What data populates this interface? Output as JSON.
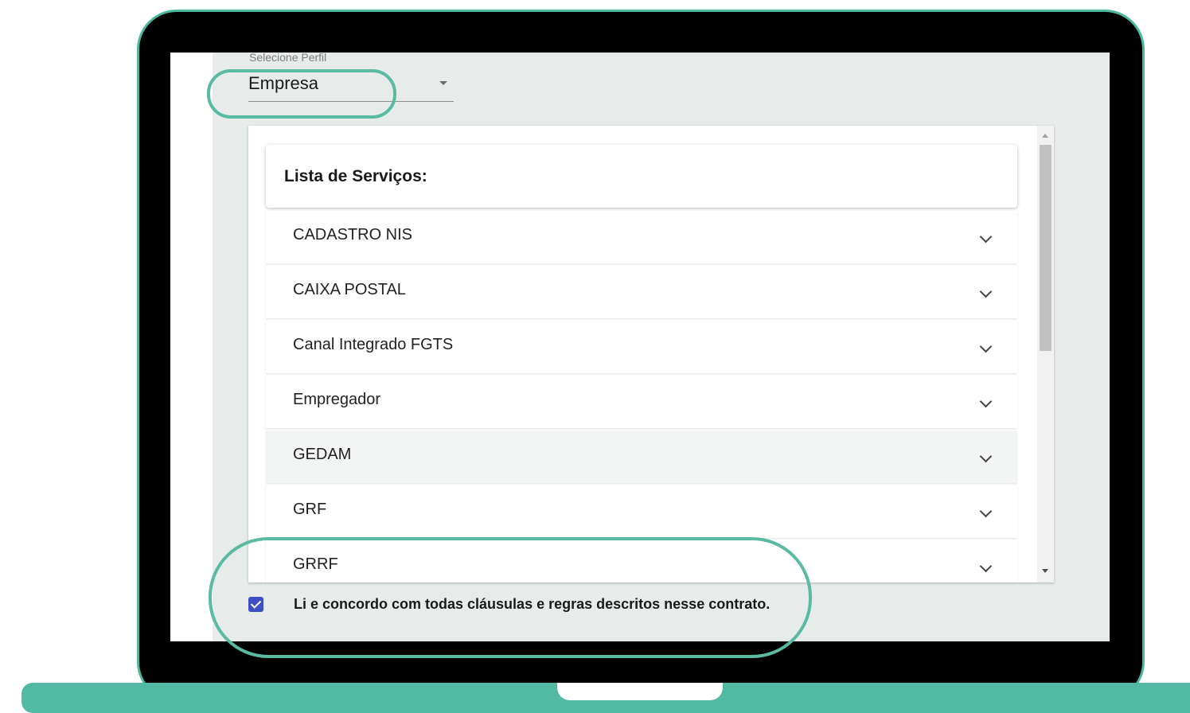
{
  "profile_select": {
    "label": "Selecione Perfil",
    "value": "Empresa"
  },
  "services": {
    "title": "Lista de Serviços:",
    "items": [
      {
        "label": "CADASTRO NIS"
      },
      {
        "label": "CAIXA POSTAL"
      },
      {
        "label": "Canal Integrado FGTS"
      },
      {
        "label": "Empregador"
      },
      {
        "label": "GEDAM"
      },
      {
        "label": "GRF"
      },
      {
        "label": "GRRF"
      }
    ]
  },
  "agreement": {
    "text": "Li e concordo com todas cláusulas e regras descritos nesse contrato.",
    "checked": true
  },
  "colors": {
    "accent": "#5abaa2",
    "checkbox": "#3c4fc7",
    "background": "#e7eceb"
  }
}
